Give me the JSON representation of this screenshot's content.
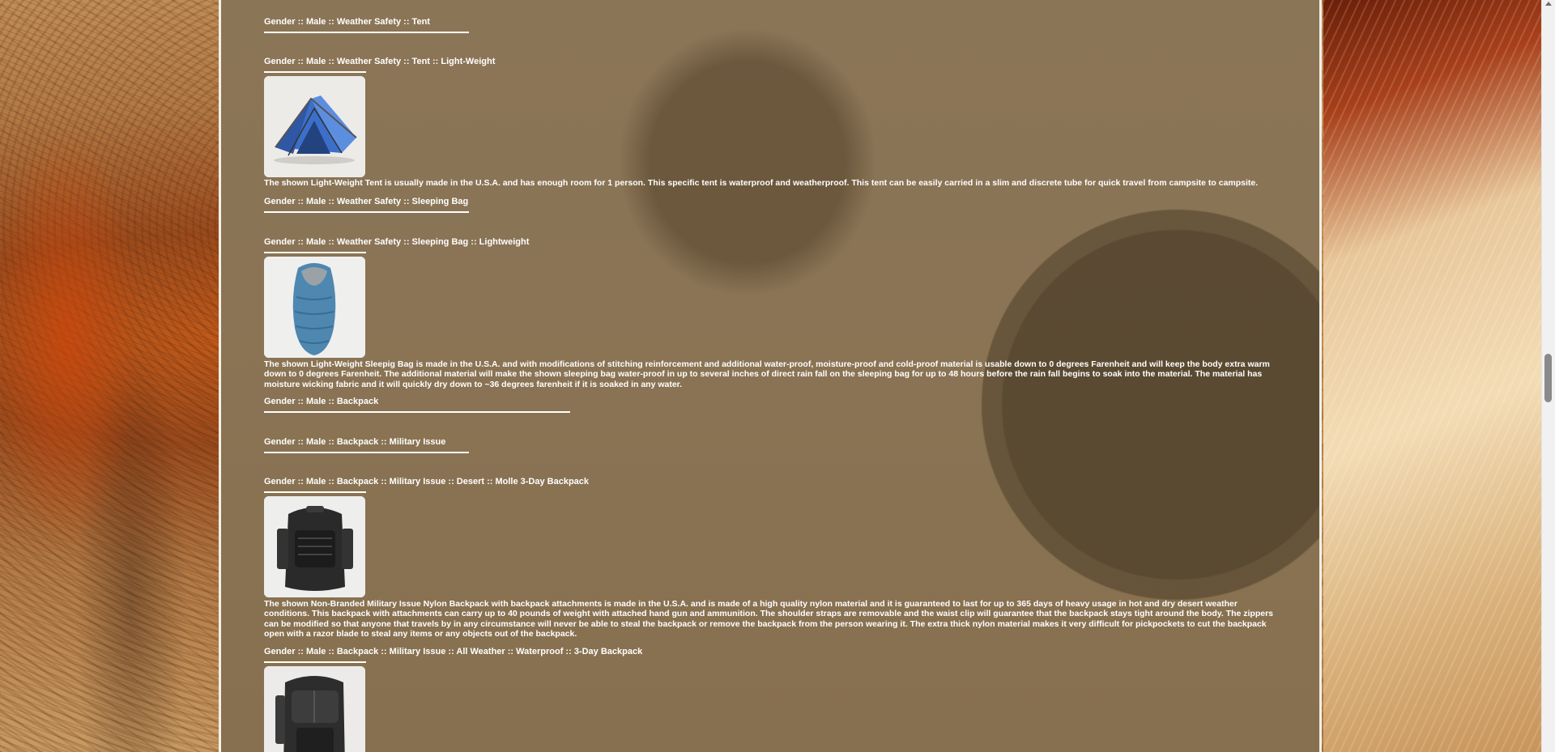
{
  "sections": [
    {
      "heading": "Gender :: Male :: Weather Safety :: Tent"
    },
    {
      "heading": "Gender :: Male :: Weather Safety :: Tent :: Light-Weight",
      "description": "The shown Light-Weight Tent is usually made in the U.S.A. and has enough room for 1 person. This specific tent is waterproof and weatherproof. This tent can be easily carried in a slim and discrete tube for quick travel from campsite to campsite."
    },
    {
      "heading": "Gender :: Male :: Weather Safety :: Sleeping Bag"
    },
    {
      "heading": "Gender :: Male :: Weather Safety :: Sleeping Bag :: Lightweight",
      "description": "The shown Light-Weight Sleepig Bag is made in the U.S.A. and with modifications of stitching reinforcement and additional water-proof, moisture-proof and cold-proof material is usable down to 0 degrees Farenheit and will keep the body extra warm down to 0 degrees Farenheit. The additional material will make the shown sleeping bag water-proof in up to several inches of direct rain fall on the sleeping bag for up to 48 hours before the rain fall begins to soak into the material. The material has moisture wicking fabric and it will quickly dry down to ~36 degrees farenheit if it is soaked in any water."
    },
    {
      "heading": "Gender :: Male :: Backpack"
    },
    {
      "heading": "Gender :: Male :: Backpack :: Military Issue"
    },
    {
      "heading": "Gender :: Male :: Backpack :: Military Issue :: Desert :: Molle 3-Day Backpack",
      "description": "The shown Non-Branded Military Issue Nylon Backpack with backpack attachments is made in the U.S.A. and is made of a high quality nylon material and it is guaranteed to last for up to 365 days of heavy usage in hot and dry desert weather conditions. This backpack with attachments can carry up to 40 pounds of weight with attached hand gun and ammunition. The shoulder straps are removable and the waist clip will guarantee that the backpack stays tight around the body. The zippers can be modified so that anyone that travels by in any circumstance will never be able to steal the backpack or remove the backpack from the person wearing it. The extra thick nylon material makes it very difficult for pickpockets to cut the backpack open with a razor blade to steal any items or any objects out of the backpack."
    },
    {
      "heading": "Gender :: Male :: Backpack :: Military Issue :: All Weather :: Waterproof :: 3-Day Backpack"
    }
  ],
  "images": {
    "tent": "blue-dome-tent",
    "sleeping_bag": "blue-mummy-sleeping-bag",
    "molle_backpack": "black-molle-backpack",
    "waterproof_backpack": "black-waterproof-backpack"
  }
}
